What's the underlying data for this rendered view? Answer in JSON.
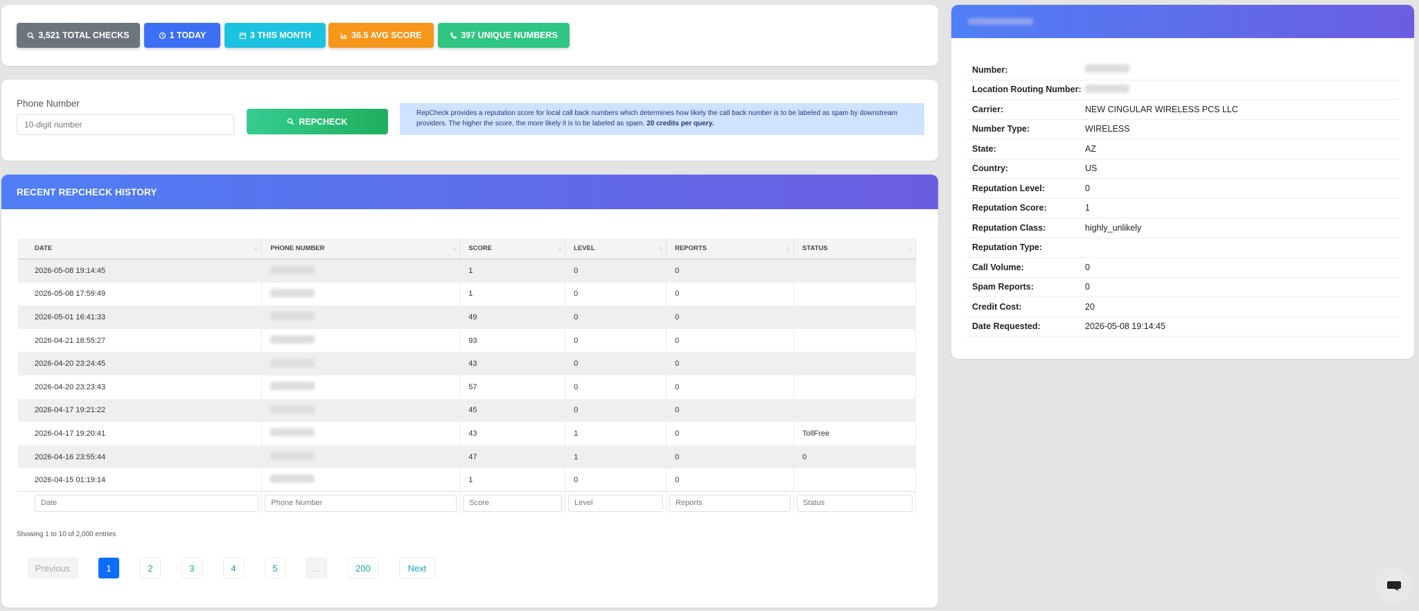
{
  "stats": {
    "total_checks": "3,521 TOTAL CHECKS",
    "today": "1 TODAY",
    "this_month": "3 THIS MONTH",
    "avg_score": "36.5 AVG SCORE",
    "unique_numbers": "397 UNIQUE NUMBERS",
    "colors": {
      "total": "#6c757d",
      "today": "#3d6ff5",
      "month": "#1cc3e0",
      "avg": "#f6961a",
      "unique": "#2fc582"
    }
  },
  "search": {
    "label": "Phone Number",
    "placeholder": "10-digit number",
    "button_label": "REPCHECK",
    "info_text": "RepCheck provides a reputation score for local call back numbers which determines how likely the call back number is to be labeled as spam by downstream providers. The higher the score, the more likely it is to be labeled as spam.",
    "info_bold": "20 credits per query."
  },
  "history": {
    "title": "RECENT REPCHECK HISTORY",
    "columns": [
      "DATE",
      "PHONE NUMBER",
      "SCORE",
      "LEVEL",
      "REPORTS",
      "STATUS"
    ],
    "rows": [
      {
        "date": "2026-05-08 19:14:45",
        "score": "1",
        "level": "0",
        "reports": "0",
        "status": ""
      },
      {
        "date": "2026-05-08 17:59:49",
        "score": "1",
        "level": "0",
        "reports": "0",
        "status": ""
      },
      {
        "date": "2026-05-01 16:41:33",
        "score": "49",
        "level": "0",
        "reports": "0",
        "status": ""
      },
      {
        "date": "2026-04-21 18:55:27",
        "score": "93",
        "level": "0",
        "reports": "0",
        "status": ""
      },
      {
        "date": "2026-04-20 23:24:45",
        "score": "43",
        "level": "0",
        "reports": "0",
        "status": ""
      },
      {
        "date": "2026-04-20 23:23:43",
        "score": "57",
        "level": "0",
        "reports": "0",
        "status": ""
      },
      {
        "date": "2026-04-17 19:21:22",
        "score": "45",
        "level": "0",
        "reports": "0",
        "status": ""
      },
      {
        "date": "2026-04-17 19:20:41",
        "score": "43",
        "level": "1",
        "reports": "0",
        "status": "TollFree"
      },
      {
        "date": "2026-04-16 23:55:44",
        "score": "47",
        "level": "1",
        "reports": "0",
        "status": "0"
      },
      {
        "date": "2026-04-15 01:19:14",
        "score": "1",
        "level": "0",
        "reports": "0",
        "status": ""
      }
    ],
    "filters": [
      "Date",
      "Phone Number",
      "Score",
      "Level",
      "Reports",
      "Status"
    ],
    "showing": "Showing 1 to 10 of 2,000 entries",
    "pagination": {
      "previous": "Previous",
      "pages": [
        "1",
        "2",
        "3",
        "4",
        "5",
        "...",
        "200"
      ],
      "next": "Next"
    }
  },
  "report": {
    "rows": [
      {
        "label": "Number:",
        "value": ""
      },
      {
        "label": "Location Routing Number:",
        "value": ""
      },
      {
        "label": "Carrier:",
        "value": "NEW CINGULAR WIRELESS PCS LLC"
      },
      {
        "label": "Number Type:",
        "value": "WIRELESS"
      },
      {
        "label": "State:",
        "value": "AZ"
      },
      {
        "label": "Country:",
        "value": "US"
      },
      {
        "label": "Reputation Level:",
        "value": "0"
      },
      {
        "label": "Reputation Score:",
        "value": "1"
      },
      {
        "label": "Reputation Class:",
        "value": "highly_unlikely"
      },
      {
        "label": "Reputation Type:",
        "value": ""
      },
      {
        "label": "Call Volume:",
        "value": "0"
      },
      {
        "label": "Spam Reports:",
        "value": "0"
      },
      {
        "label": "Credit Cost:",
        "value": "20"
      },
      {
        "label": "Date Requested:",
        "value": "2026-05-08 19:14:45"
      }
    ]
  }
}
